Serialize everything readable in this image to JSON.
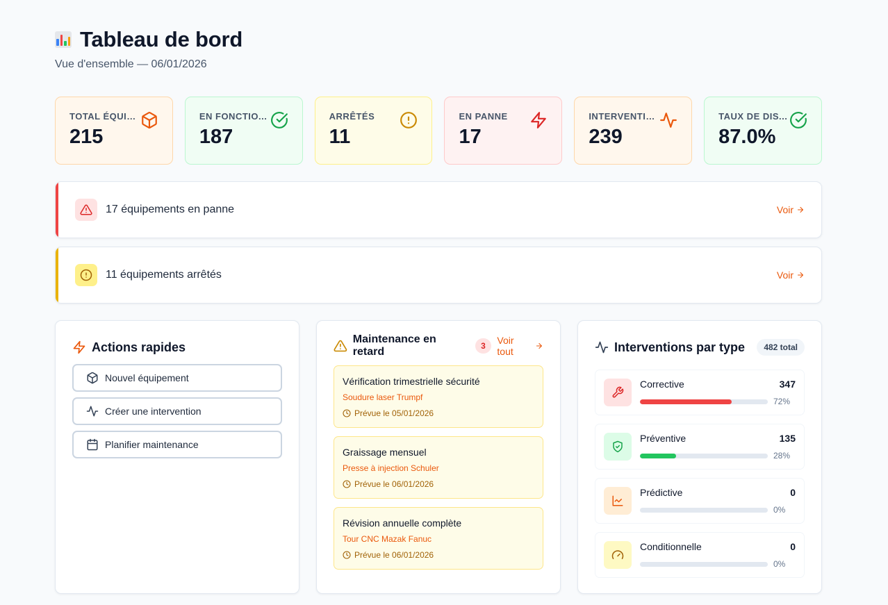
{
  "header": {
    "title_icon": "bar-chart-emoji",
    "title": "Tableau de bord",
    "subtitle": "Vue d'ensemble — 06/01/2026"
  },
  "stats": [
    {
      "label": "TOTAL ÉQUIP...",
      "value": "215",
      "icon": "box-icon",
      "color": "#ea580c"
    },
    {
      "label": "EN FONCTIO...",
      "value": "187",
      "icon": "check-circle-icon",
      "color": "#16a34a"
    },
    {
      "label": "ARRÊTÉS",
      "value": "11",
      "icon": "alert-circle-icon",
      "color": "#ca8a04"
    },
    {
      "label": "EN PANNE",
      "value": "17",
      "icon": "zap-icon",
      "color": "#dc2626"
    },
    {
      "label": "INTERVENTIO...",
      "value": "239",
      "icon": "activity-icon",
      "color": "#ea580c"
    },
    {
      "label": "TAUX DE DIS...",
      "value": "87.0%",
      "icon": "check-circle-icon",
      "color": "#16a34a"
    }
  ],
  "alerts": [
    {
      "text": "17 équipements en panne",
      "link": "Voir",
      "icon": "alert-triangle-icon",
      "color": "#dc2626"
    },
    {
      "text": "11 équipements arrêtés",
      "link": "Voir",
      "icon": "alert-circle-icon",
      "color": "#ca8a04"
    }
  ],
  "quick_actions": {
    "title": "Actions rapides",
    "items": [
      {
        "label": "Nouvel équipement",
        "icon": "box-icon"
      },
      {
        "label": "Créer une intervention",
        "icon": "activity-icon"
      },
      {
        "label": "Planifier maintenance",
        "icon": "calendar-icon"
      }
    ]
  },
  "overdue": {
    "title": "Maintenance en retard",
    "count": "3",
    "see_all": "Voir tout",
    "items": [
      {
        "title": "Vérification trimestrielle sécurité",
        "equipment": "Soudure laser Trumpf",
        "date": "Prévue le 05/01/2026"
      },
      {
        "title": "Graissage mensuel",
        "equipment": "Presse à injection Schuler",
        "date": "Prévue le 06/01/2026"
      },
      {
        "title": "Révision annuelle complète",
        "equipment": "Tour CNC Mazak Fanuc",
        "date": "Prévue le 06/01/2026"
      }
    ]
  },
  "by_type": {
    "title": "Interventions par type",
    "total": "482 total",
    "items": [
      {
        "name": "Corrective",
        "count": "347",
        "pct": "72%",
        "fill": 0.72,
        "color": "#ef4444",
        "icon": "wrench-icon"
      },
      {
        "name": "Préventive",
        "count": "135",
        "pct": "28%",
        "fill": 0.28,
        "color": "#22c55e",
        "icon": "shield-check-icon"
      },
      {
        "name": "Prédictive",
        "count": "0",
        "pct": "0%",
        "fill": 0,
        "color": "#f97316",
        "icon": "line-chart-icon"
      },
      {
        "name": "Conditionnelle",
        "count": "0",
        "pct": "0%",
        "fill": 0,
        "color": "#eab308",
        "icon": "gauge-icon"
      }
    ]
  }
}
